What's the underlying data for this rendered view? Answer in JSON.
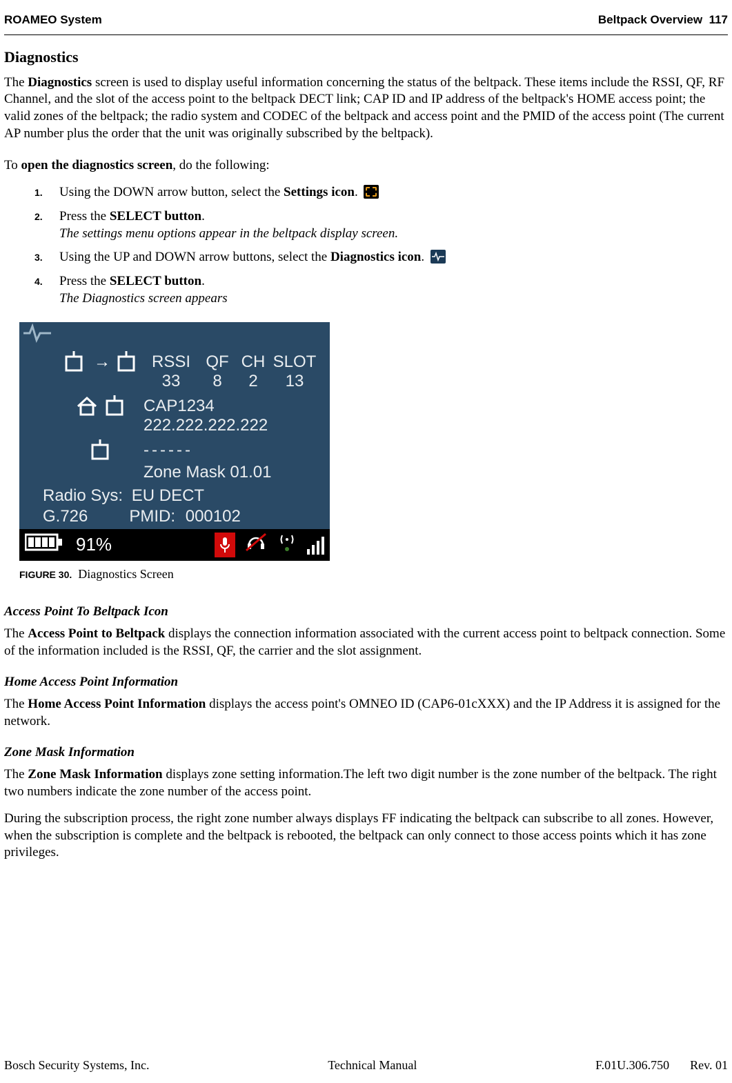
{
  "header": {
    "left": "ROAMEO System",
    "right_section": "Beltpack Overview",
    "page_number": "117"
  },
  "title": "Diagnostics",
  "intro": "The Diagnostics screen is used to display useful information concerning the status of the beltpack. These items include the RSSI, QF, RF Channel, and the slot of the access point to the beltpack DECT link; CAP ID and IP address of the beltpack's HOME access point; the valid zones of the beltpack; the radio system and CODEC of the beltpack and access point and the PMID of the access point (The current AP number plus the order that the unit was originally subscribed by the beltpack).",
  "opener_prefix": "To ",
  "opener_bold": "open the diagnostics screen",
  "opener_suffix": ", do the following:",
  "steps": [
    {
      "num": "1.",
      "text_a": "Using the DOWN arrow button, select the ",
      "text_bold": "Settings icon",
      "text_b": ".",
      "icon": "settings-icon"
    },
    {
      "num": "2.",
      "text_a": "Press the ",
      "text_bold": "SELECT button",
      "text_b": ".",
      "result": "The settings menu options appear in the beltpack display screen."
    },
    {
      "num": "3.",
      "text_a": "Using the UP and DOWN arrow buttons, select the ",
      "text_bold": "Diagnostics icon",
      "text_b": ".",
      "icon": "diagnostics-icon"
    },
    {
      "num": "4.",
      "text_a": "Press the ",
      "text_bold": "SELECT button",
      "text_b": ".",
      "result": "The Diagnostics screen appears"
    }
  ],
  "screenshot": {
    "headers": {
      "c1": "RSSI",
      "c2": "QF",
      "c3": "CH",
      "c4": "SLOT"
    },
    "values": {
      "c1": "33",
      "c2": "8",
      "c3": "2",
      "c4": "13"
    },
    "cap_id": "CAP1234",
    "ip": "222.222.222.222",
    "dashes": "------",
    "zone_mask": "Zone Mask 01.01",
    "radio_sys_label": "Radio Sys:",
    "radio_sys_value": "EU DECT",
    "codec": "G.726",
    "pmid_label": "PMID:",
    "pmid_value": "000102",
    "battery_pct": "91%"
  },
  "figure": {
    "label": "FIGURE 30.",
    "caption": "Diagnostics Screen"
  },
  "sections": {
    "ap2bp": {
      "heading": "Access Point To Beltpack Icon",
      "bold": "Access Point to Beltpack",
      "pre": "The ",
      "post": " displays the connection information associated with the current access point to beltpack connection. Some of the information included is the RSSI, QF, the carrier and the slot assignment."
    },
    "home": {
      "heading": "Home Access Point Information",
      "bold": "Home Access Point Information",
      "pre": "The ",
      "post": " displays the access point's OMNEO ID (CAP6-01cXXX) and the IP Address it is assigned for the network."
    },
    "zone": {
      "heading": "Zone Mask Information",
      "bold": "Zone Mask Information",
      "pre": "The ",
      "post": " displays zone setting information.The left two digit number is the zone number of the beltpack. The right two numbers indicate the zone number of the access point.",
      "p2": "During the subscription process, the right zone number always displays FF indicating the beltpack can subscribe to all zones. However, when the subscription is complete and the beltpack is rebooted, the beltpack can only connect to those access points which it has zone privileges."
    }
  },
  "footer": {
    "left": "Bosch Security Systems, Inc.",
    "center": "Technical Manual",
    "docnum": "F.01U.306.750",
    "rev": "Rev. 01"
  }
}
